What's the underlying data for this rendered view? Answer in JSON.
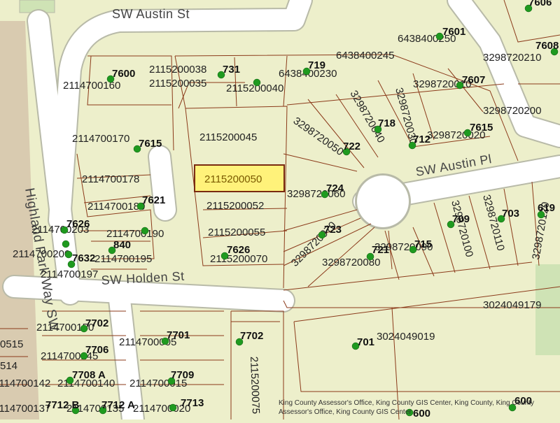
{
  "streets": {
    "austin_st": "SW Austin St",
    "austin_pl": "SW Austin Pl",
    "holden_st": "SW Holden St",
    "highland_park_way": "Highland Park Way SW"
  },
  "highlighted_parcel": "2115200050",
  "parcels": {
    "p1": "6438400245",
    "p2": "6438400230",
    "p3": "6438400250",
    "p4": "3298720210",
    "p5": "3298720010",
    "p6": "3298720200",
    "p7": "3298720020",
    "p8": "2115200038",
    "p9": "2115200035",
    "p10": "2115200040",
    "p11": "2114700160",
    "p12": "2115200045",
    "p13": "3298720050",
    "p14": "3298720040",
    "p15": "3298720030",
    "p16": "2114700170",
    "p17": "2114700178",
    "p18": "2114700180",
    "p19": "2115200052",
    "p20": "3298720060",
    "p21": "2114700203",
    "p22": "2114700190",
    "p23": "2115200055",
    "p24": "3298720070",
    "p25": "2114700200",
    "p26": "2114700195",
    "p27": "2114700197",
    "p28": "2115200070",
    "p29": "3298720080",
    "p30": "3298720090",
    "p31": "3298720100",
    "p32": "3298720110",
    "p33": "3298720120",
    "p34": "3024049179",
    "p35": "2114700150",
    "p36": "2114700005",
    "p37": "3024049019",
    "p38": "2114700145",
    "p39": "2115200075",
    "p40": "2114700140",
    "p41": "2114700015",
    "p42": "2114700142",
    "p43": "2114700137",
    "p44": "2114700135",
    "p45": "2114700020",
    "p46": "0515",
    "p47": "514"
  },
  "addresses": {
    "a1": "7606",
    "a2": "7601",
    "a3": "7608",
    "a4": "7600",
    "a5": "731",
    "a6": "719",
    "a7": "7607",
    "a8": "718",
    "a9": "7615",
    "a10": "722",
    "a11": "712",
    "a12": "7615",
    "a13": "724",
    "a14": "7621",
    "a15": "7626",
    "a16": "840",
    "a17": "7632",
    "a18": "7626",
    "a19": "723",
    "a20": "721",
    "a21": "715",
    "a22": "709",
    "a23": "703",
    "a24": "619",
    "a25": "7702",
    "a26": "7701",
    "a27": "7702",
    "a28": "701",
    "a29": "7706",
    "a30": "7708 A",
    "a31": "7709",
    "a32": "7712 B",
    "a33": "7712 A",
    "a34": "7713",
    "a35": "600",
    "a36": "600"
  },
  "credits": "King County Assessor's Office, King County GIS Center, King County, King County Assessor's Office, King County GIS Center",
  "colors": {
    "background": "#EDEFCB",
    "road": "#FFFFFF",
    "road_edge": "#B8BAA8",
    "parcel_line": "#8B3A1A",
    "highlight_fill": "#FFF27A",
    "highlight_stroke": "#7A2A10",
    "pin": "#1F9A1F",
    "park": "#CFE3B5",
    "highway": "#D9CBB0"
  }
}
